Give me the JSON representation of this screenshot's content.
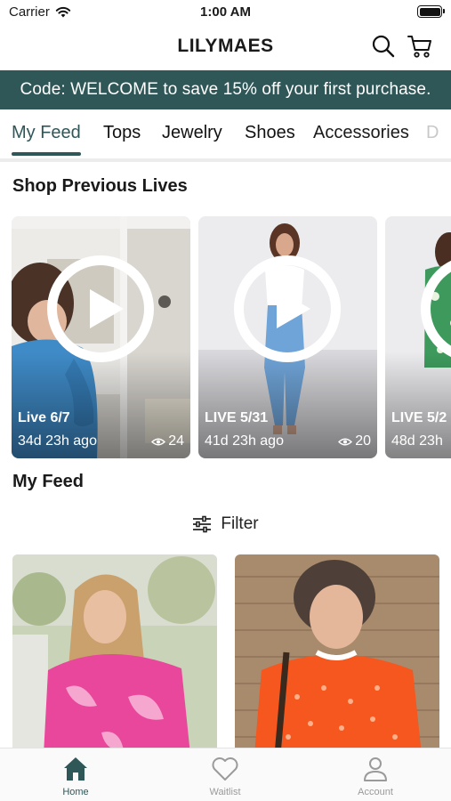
{
  "status_bar": {
    "carrier": "Carrier",
    "time": "1:00 AM"
  },
  "header": {
    "brand": "LILYMAES",
    "icons": [
      "search-icon",
      "cart-icon"
    ]
  },
  "promo": {
    "text": "Code: WELCOME to save 15% off your first purchase."
  },
  "tabs": [
    {
      "label": "My Feed",
      "active": true
    },
    {
      "label": "Tops"
    },
    {
      "label": "Jewelry"
    },
    {
      "label": "Shoes"
    },
    {
      "label": "Accessories"
    },
    {
      "label": "D"
    }
  ],
  "previous_lives": {
    "title": "Shop Previous Lives",
    "cards": [
      {
        "title": "Live 6/7",
        "ago": "34d 23h ago",
        "views": "24"
      },
      {
        "title": "LIVE 5/31",
        "ago": "41d 23h ago",
        "views": "20"
      },
      {
        "title": "LIVE 5/2",
        "ago": "48d 23h",
        "views": ""
      }
    ]
  },
  "feed": {
    "title": "My Feed",
    "filter_label": "Filter"
  },
  "bottom_nav": [
    {
      "label": "Home",
      "icon": "home-icon",
      "active": true
    },
    {
      "label": "Waitlist",
      "icon": "heart-icon"
    },
    {
      "label": "Account",
      "icon": "person-icon"
    }
  ],
  "colors": {
    "accent": "#2f5758",
    "banner": "#2f5758",
    "inactive": "#9a9a9a"
  }
}
